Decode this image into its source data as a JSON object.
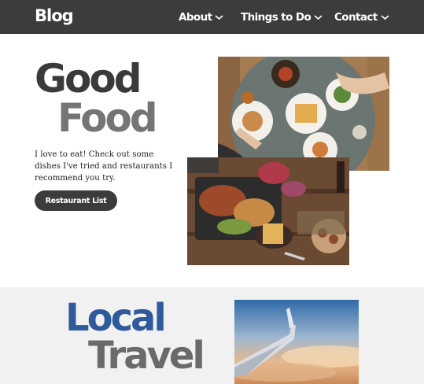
{
  "nav": {
    "logo": "Blog",
    "items": [
      {
        "label": "About"
      },
      {
        "label": "Things to Do"
      },
      {
        "label": "Contact"
      }
    ]
  },
  "hero": {
    "title_line1": "Good",
    "title_line2": "Food",
    "description": "I love to eat! Check out some dishes I've tried and restaurants I recommend you try.",
    "button_label": "Restaurant List"
  },
  "travel": {
    "title_line1": "Local",
    "title_line2": "Travel"
  },
  "colors": {
    "nav_bg": "#3c3c3c",
    "accent_blue": "#2f5a9c",
    "band_bg": "#f1f1f1"
  }
}
